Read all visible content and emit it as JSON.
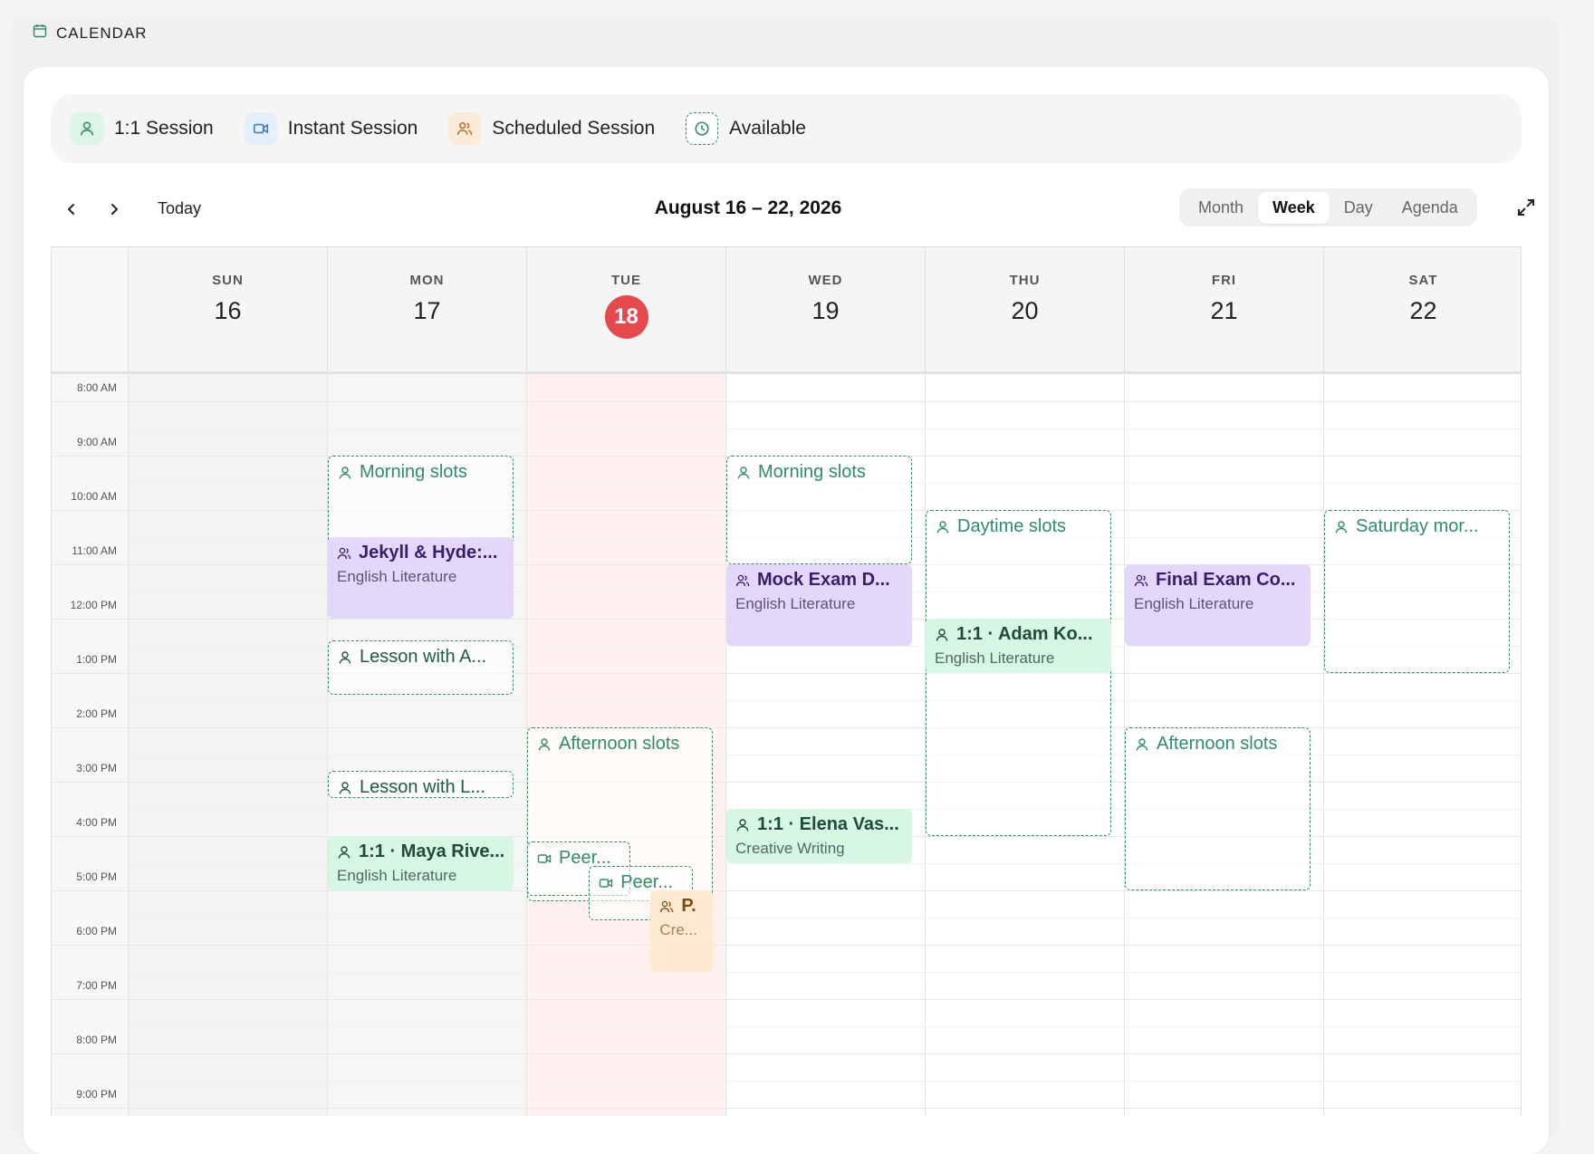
{
  "app": {
    "title": "CALENDAR"
  },
  "legend": [
    {
      "label": "1:1 Session",
      "icon": "person-icon",
      "bg": "#dcf5e7"
    },
    {
      "label": "Instant Session",
      "icon": "video-icon",
      "bg": "#e3effb"
    },
    {
      "label": "Scheduled Session",
      "icon": "users-icon",
      "bg": "#fdebd9"
    },
    {
      "label": "Available",
      "icon": "clock-icon",
      "bg": "#ffffff"
    }
  ],
  "toolbar": {
    "today_label": "Today",
    "range_title": "August 16 – 22, 2026",
    "views": [
      "Month",
      "Week",
      "Day",
      "Agenda"
    ],
    "active_view": "Week"
  },
  "days": [
    {
      "name": "SUN",
      "num": "16"
    },
    {
      "name": "MON",
      "num": "17"
    },
    {
      "name": "TUE",
      "num": "18",
      "today": true
    },
    {
      "name": "WED",
      "num": "19"
    },
    {
      "name": "THU",
      "num": "20"
    },
    {
      "name": "FRI",
      "num": "21"
    },
    {
      "name": "SAT",
      "num": "22"
    }
  ],
  "times": [
    "8:00 AM",
    "9:00 AM",
    "10:00 AM",
    "11:00 AM",
    "12:00 PM",
    "1:00 PM",
    "2:00 PM",
    "3:00 PM",
    "4:00 PM",
    "5:00 PM",
    "6:00 PM",
    "7:00 PM",
    "8:00 PM",
    "9:00 PM"
  ],
  "events": [
    {
      "kind": "avail",
      "day": 1,
      "start": 9.0,
      "end": 12.0,
      "title": "Morning slots",
      "icon": "person"
    },
    {
      "kind": "group",
      "day": 1,
      "start": 10.5,
      "end": 12.0,
      "title": "Jekyll & Hyde:...",
      "sub": "English Literature",
      "icon": "users"
    },
    {
      "kind": "avail",
      "day": 1,
      "start": 12.4,
      "end": 13.4,
      "title": "Lesson with A...",
      "icon": "person",
      "dark": true
    },
    {
      "kind": "avail",
      "day": 1,
      "start": 14.8,
      "end": 15.3,
      "title": "Lesson with L...",
      "icon": "person",
      "dark": true
    },
    {
      "kind": "one",
      "day": 1,
      "start": 16.0,
      "end": 17.0,
      "title": "1:1 · Maya Rive...",
      "sub": "English Literature",
      "icon": "person"
    },
    {
      "kind": "avail",
      "day": 2,
      "start": 14.0,
      "end": 17.2,
      "title": "Afternoon slots",
      "icon": "person"
    },
    {
      "kind": "instant",
      "day": 2,
      "start": 16.1,
      "end": 17.1,
      "title": "Peer...",
      "icon": "video",
      "left": 0,
      "width": 0.52
    },
    {
      "kind": "instant",
      "day": 2,
      "start": 16.55,
      "end": 17.55,
      "title": "Peer...",
      "icon": "video",
      "left": 0.31,
      "width": 0.52
    },
    {
      "kind": "sched",
      "day": 2,
      "start": 17.0,
      "end": 18.5,
      "title": "P.",
      "sub": "Cre...",
      "icon": "users",
      "left": 0.62,
      "width": 0.31
    },
    {
      "kind": "avail",
      "day": 3,
      "start": 9.0,
      "end": 11.0,
      "title": "Morning slots",
      "icon": "person"
    },
    {
      "kind": "group",
      "day": 3,
      "start": 11.0,
      "end": 12.5,
      "title": "Mock Exam D...",
      "sub": "English Literature",
      "icon": "users"
    },
    {
      "kind": "one",
      "day": 3,
      "start": 15.5,
      "end": 16.5,
      "title": "1:1 · Elena Vas...",
      "sub": "Creative Writing",
      "icon": "person"
    },
    {
      "kind": "avail",
      "day": 4,
      "start": 10.0,
      "end": 16.0,
      "title": "Daytime slots",
      "icon": "person"
    },
    {
      "kind": "one",
      "day": 4,
      "start": 12.0,
      "end": 13.0,
      "title": "1:1 · Adam Ko...",
      "sub": "English Literature",
      "icon": "person"
    },
    {
      "kind": "group",
      "day": 5,
      "start": 11.0,
      "end": 12.5,
      "title": "Final Exam Co...",
      "sub": "English Literature",
      "icon": "users"
    },
    {
      "kind": "avail",
      "day": 5,
      "start": 14.0,
      "end": 17.0,
      "title": "Afternoon slots",
      "icon": "person"
    },
    {
      "kind": "avail",
      "day": 6,
      "start": 10.0,
      "end": 13.0,
      "title": "Saturday mor...",
      "icon": "person"
    }
  ]
}
